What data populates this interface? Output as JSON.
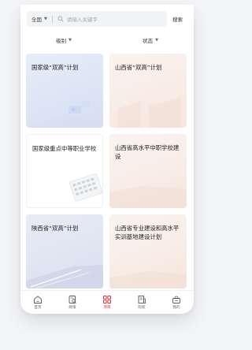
{
  "search": {
    "region": "全国",
    "placeholder": "请输入关键字",
    "button": "搜索"
  },
  "filters": {
    "level": "级别",
    "status": "状态"
  },
  "cards": [
    {
      "title": "国家级“双高”计划"
    },
    {
      "title": "山西省“双高”计划"
    },
    {
      "title": "国家级重点中等职业学校"
    },
    {
      "title": "山西省高水平中职学校建设"
    },
    {
      "title": "陕西省“双高”计划"
    },
    {
      "title": "山西省专业建设和高水平实训基地建设计划"
    }
  ],
  "tabbar": {
    "items": [
      {
        "label": "首页",
        "icon": "home-icon"
      },
      {
        "label": "政策",
        "icon": "policy-icon"
      },
      {
        "label": "项目",
        "icon": "project-grid-icon",
        "active": true
      },
      {
        "label": "院校",
        "icon": "school-icon"
      },
      {
        "label": "我的",
        "icon": "profile-icon"
      }
    ]
  },
  "colors": {
    "accent": "#d2363a",
    "background": "#f4f5f7"
  }
}
